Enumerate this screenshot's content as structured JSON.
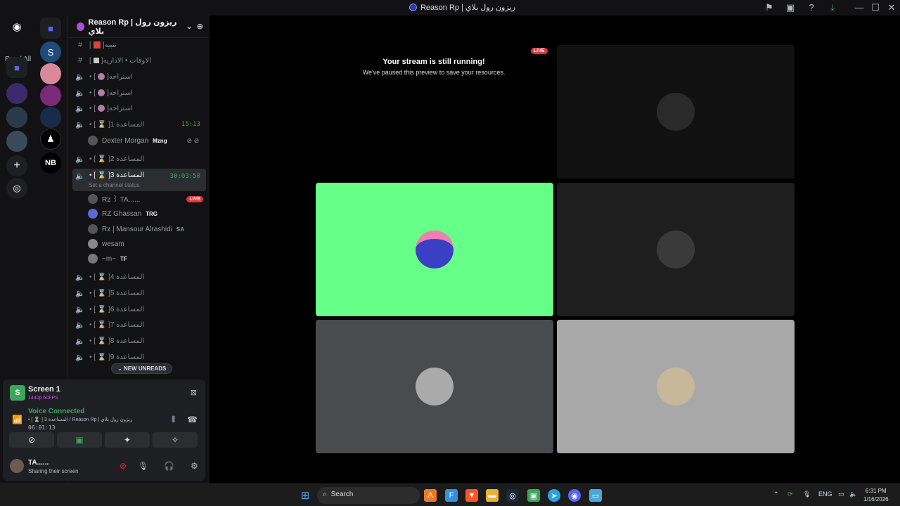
{
  "window": {
    "title": "Reason Rp | ريزون رول بلاي"
  },
  "guilds": {
    "read_all": "Read All"
  },
  "server": {
    "name": "Reason Rp | ريزون رول بلاي"
  },
  "channels": [
    {
      "name": "تنبيه",
      "type": "text"
    },
    {
      "name": "الاوقات • الاداريه",
      "type": "text"
    },
    {
      "name": "استراحه",
      "type": "voice"
    },
    {
      "name": "استراحه",
      "type": "voice"
    },
    {
      "name": "استراحه",
      "type": "voice"
    },
    {
      "name": "المساعدة 1",
      "type": "voice",
      "timer": "15:13"
    },
    {
      "name": "المساعدة 2",
      "type": "voice"
    },
    {
      "name": "المساعدة 3",
      "type": "voice",
      "timer": "30:03:50",
      "status": "Set a channel status"
    },
    {
      "name": "المساعدة 4",
      "type": "voice"
    },
    {
      "name": "المساعدة 5",
      "type": "voice"
    },
    {
      "name": "المساعدة 6",
      "type": "voice"
    },
    {
      "name": "المساعدة 7",
      "type": "voice"
    },
    {
      "name": "المساعدة 8",
      "type": "voice"
    },
    {
      "name": "المساعدة 9",
      "type": "voice"
    }
  ],
  "voice_users_ch1": [
    {
      "name": "Dexter Morgan",
      "tag": "Mzng"
    }
  ],
  "voice_users_ch3": [
    {
      "name": "Rz ꒱ TA......",
      "tag": "",
      "live": "LIVE"
    },
    {
      "name": "RZ Ghassan",
      "tag": "TRG"
    },
    {
      "name": "Rz | Mansour Alrashidi",
      "tag": "SA"
    },
    {
      "name": "wesam",
      "tag": ""
    },
    {
      "name": "~m~",
      "tag": "TF"
    }
  ],
  "new_unreads": "NEW UNREADS",
  "panel": {
    "screen_title": "Screen 1",
    "screen_sub": "1440p 60FPS",
    "voice_title": "Voice Connected",
    "voice_sub": "• [ ⌛ ] المساعدة 3 / Reason Rp | ريزون رول بلاي",
    "voice_time": "06:01:13",
    "user_name": "TA......",
    "user_status": "Sharing their screen"
  },
  "stage": {
    "stream_title": "Your stream is still running!",
    "stream_sub": "We've paused this preview to save your resources.",
    "live": "LIVE"
  },
  "taskbar": {
    "search": "Search",
    "lang": "ENG",
    "time": "6:31 PM",
    "date": "1/16/2026"
  },
  "colors": {
    "green_tile": "#66ff88",
    "accent_green": "#3ba55d",
    "live_red": "#da373c"
  }
}
